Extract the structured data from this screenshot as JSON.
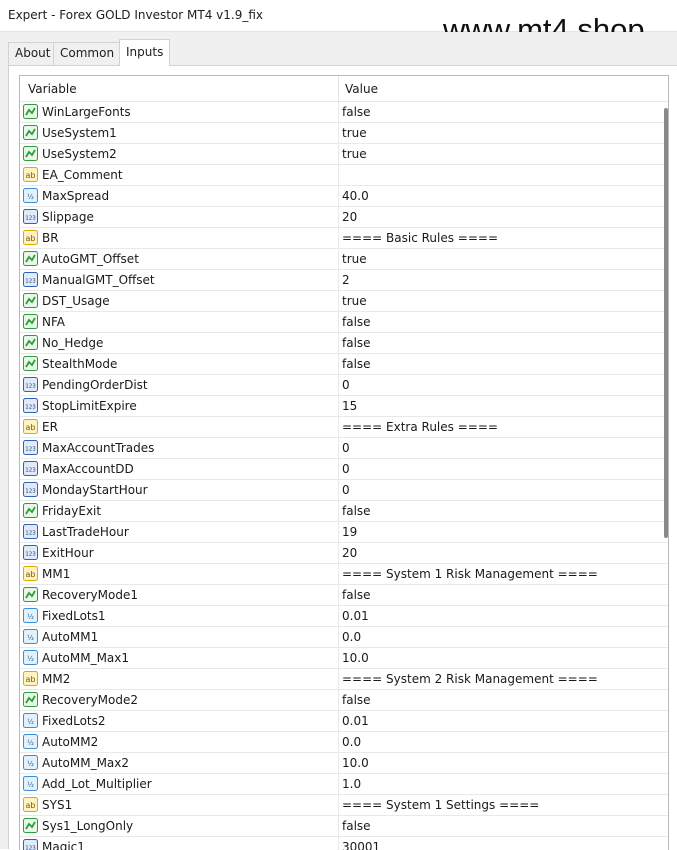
{
  "window": {
    "title": "Expert - Forex GOLD Investor MT4 v1.9_fix",
    "watermark": "www.mt4.shop"
  },
  "tabs": [
    {
      "label": "About",
      "active": false
    },
    {
      "label": "Common",
      "active": false
    },
    {
      "label": "Inputs",
      "active": true
    }
  ],
  "columns": {
    "variable": "Variable",
    "value": "Value"
  },
  "icon_kinds": {
    "bool": {
      "icon": "bool-toggle-icon",
      "color": "#2e9e3a"
    },
    "string": {
      "icon": "ab-string-icon",
      "color": "#e0a800"
    },
    "double": {
      "icon": "half-double-icon",
      "color": "#3b8fd6"
    },
    "int": {
      "icon": "int-123-icon",
      "color": "#2f63b8"
    }
  },
  "rows": [
    {
      "type": "bool",
      "variable": "WinLargeFonts",
      "value": "false"
    },
    {
      "type": "bool",
      "variable": "UseSystem1",
      "value": "true"
    },
    {
      "type": "bool",
      "variable": "UseSystem2",
      "value": "true"
    },
    {
      "type": "string",
      "variable": "EA_Comment",
      "value": ""
    },
    {
      "type": "double",
      "variable": "MaxSpread",
      "value": "40.0"
    },
    {
      "type": "int",
      "variable": "Slippage",
      "value": "20"
    },
    {
      "type": "string",
      "variable": "BR",
      "value": "==== Basic Rules ===="
    },
    {
      "type": "bool",
      "variable": "AutoGMT_Offset",
      "value": "true"
    },
    {
      "type": "int",
      "variable": "ManualGMT_Offset",
      "value": "2"
    },
    {
      "type": "bool",
      "variable": "DST_Usage",
      "value": "true"
    },
    {
      "type": "bool",
      "variable": "NFA",
      "value": "false"
    },
    {
      "type": "bool",
      "variable": "No_Hedge",
      "value": "false"
    },
    {
      "type": "bool",
      "variable": "StealthMode",
      "value": "false"
    },
    {
      "type": "int",
      "variable": "PendingOrderDist",
      "value": "0"
    },
    {
      "type": "int",
      "variable": "StopLimitExpire",
      "value": "15"
    },
    {
      "type": "string",
      "variable": "ER",
      "value": "==== Extra Rules ===="
    },
    {
      "type": "int",
      "variable": "MaxAccountTrades",
      "value": "0"
    },
    {
      "type": "int",
      "variable": "MaxAccountDD",
      "value": "0"
    },
    {
      "type": "int",
      "variable": "MondayStartHour",
      "value": "0"
    },
    {
      "type": "bool",
      "variable": "FridayExit",
      "value": "false"
    },
    {
      "type": "int",
      "variable": "LastTradeHour",
      "value": "19"
    },
    {
      "type": "int",
      "variable": "ExitHour",
      "value": "20"
    },
    {
      "type": "string",
      "variable": "MM1",
      "value": "==== System 1 Risk Management ===="
    },
    {
      "type": "bool",
      "variable": "RecoveryMode1",
      "value": "false"
    },
    {
      "type": "double",
      "variable": "FixedLots1",
      "value": "0.01"
    },
    {
      "type": "double",
      "variable": "AutoMM1",
      "value": "0.0"
    },
    {
      "type": "double",
      "variable": "AutoMM_Max1",
      "value": "10.0"
    },
    {
      "type": "string",
      "variable": "MM2",
      "value": "==== System 2 Risk Management ===="
    },
    {
      "type": "bool",
      "variable": "RecoveryMode2",
      "value": "false"
    },
    {
      "type": "double",
      "variable": "FixedLots2",
      "value": "0.01"
    },
    {
      "type": "double",
      "variable": "AutoMM2",
      "value": "0.0"
    },
    {
      "type": "double",
      "variable": "AutoMM_Max2",
      "value": "10.0"
    },
    {
      "type": "double",
      "variable": "Add_Lot_Multiplier",
      "value": "1.0"
    },
    {
      "type": "string",
      "variable": "SYS1",
      "value": "==== System 1 Settings ===="
    },
    {
      "type": "bool",
      "variable": "Sys1_LongOnly",
      "value": "false"
    },
    {
      "type": "int",
      "variable": "Magic1",
      "value": "30001"
    }
  ],
  "scroll_position": 0
}
